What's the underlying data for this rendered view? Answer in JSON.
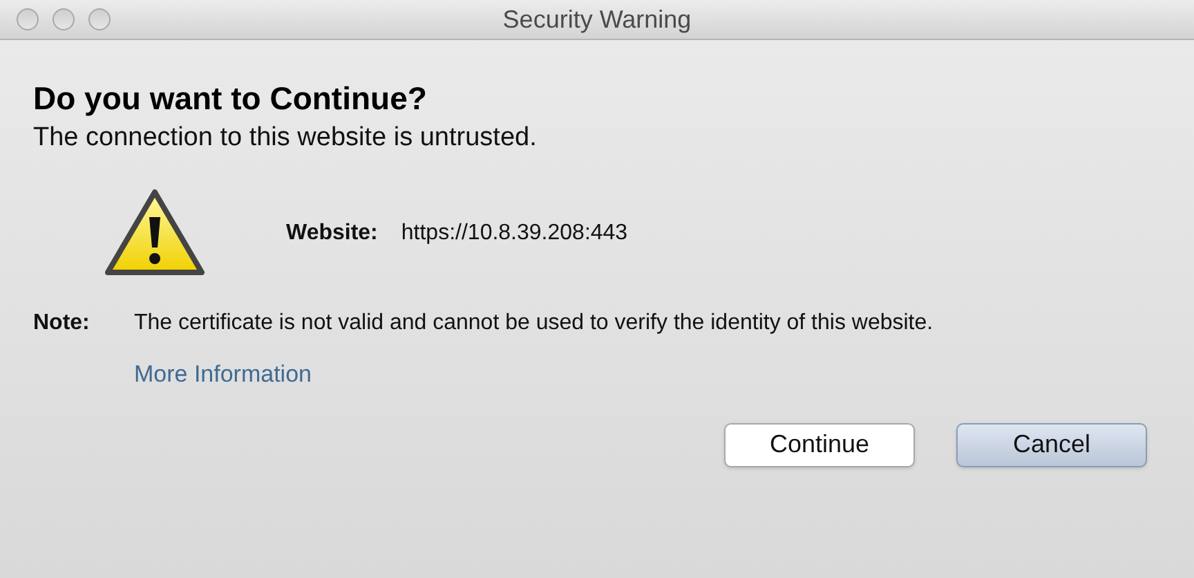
{
  "window": {
    "title": "Security Warning"
  },
  "heading": "Do you want to Continue?",
  "subtitle": "The connection to this website is untrusted.",
  "website": {
    "label": "Website:",
    "value": "https://10.8.39.208:443"
  },
  "note": {
    "label": "Note:",
    "text": "The certificate is not valid and cannot be used to verify the identity of this website.",
    "link": "More Information"
  },
  "buttons": [
    {
      "label": "Continue",
      "default": false
    },
    {
      "label": "Cancel",
      "default": true
    }
  ]
}
